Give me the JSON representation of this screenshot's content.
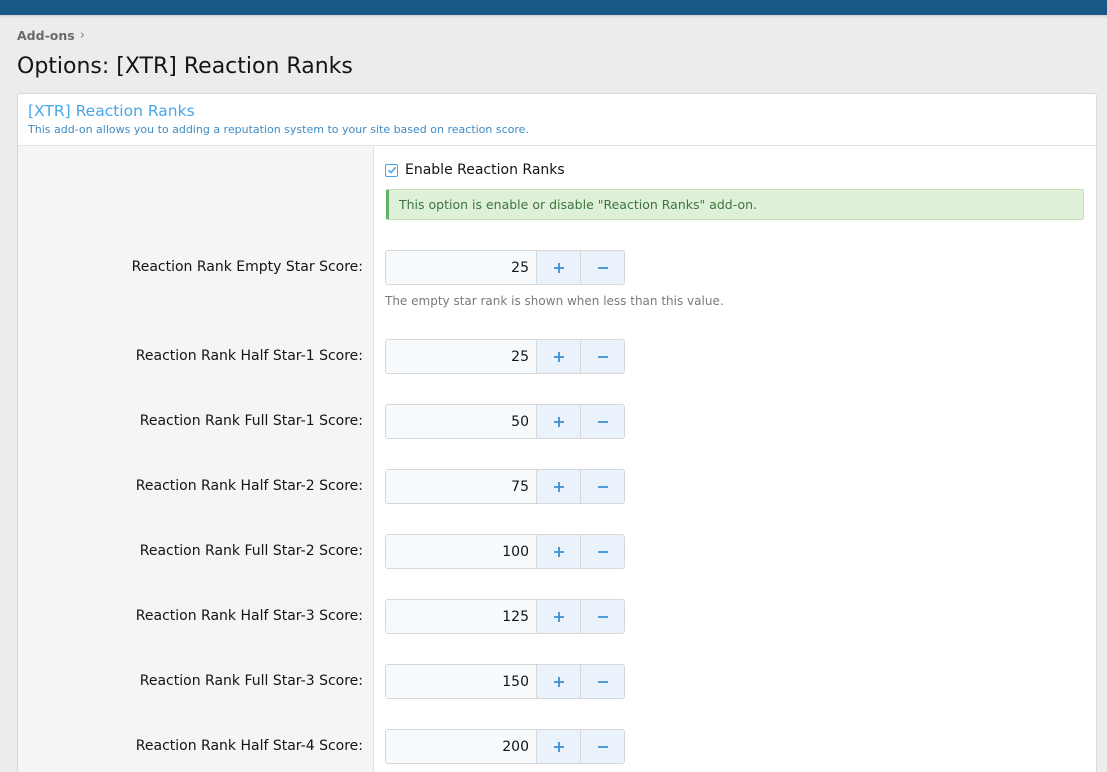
{
  "breadcrumb": {
    "item": "Add-ons",
    "separator": "›"
  },
  "page": {
    "title": "Options: [XTR] Reaction Ranks"
  },
  "block": {
    "title": "[XTR] Reaction Ranks",
    "description": "This add-on allows you to adding a reputation system to your site based on reaction score."
  },
  "enable_option": {
    "label": "Enable Reaction Ranks",
    "checked": true,
    "note": "This option is enable or disable \"Reaction Ranks\" add-on."
  },
  "options": [
    {
      "label": "Reaction Rank Empty Star Score:",
      "value": "25",
      "explain": "The empty star rank is shown when less than this value."
    },
    {
      "label": "Reaction Rank Half Star-1 Score:",
      "value": "25"
    },
    {
      "label": "Reaction Rank Full Star-1 Score:",
      "value": "50"
    },
    {
      "label": "Reaction Rank Half Star-2 Score:",
      "value": "75"
    },
    {
      "label": "Reaction Rank Full Star-2 Score:",
      "value": "100"
    },
    {
      "label": "Reaction Rank Half Star-3 Score:",
      "value": "125"
    },
    {
      "label": "Reaction Rank Full Star-3 Score:",
      "value": "150"
    },
    {
      "label": "Reaction Rank Half Star-4 Score:",
      "value": "200"
    }
  ],
  "icons": {
    "increment": "plus-icon",
    "decrement": "minus-icon",
    "checkbox": "checkmark-icon"
  },
  "colors": {
    "topbar": "#185886",
    "accent": "#47a7eb",
    "note_bg": "#dff0d8",
    "note_text": "#3c763d"
  }
}
